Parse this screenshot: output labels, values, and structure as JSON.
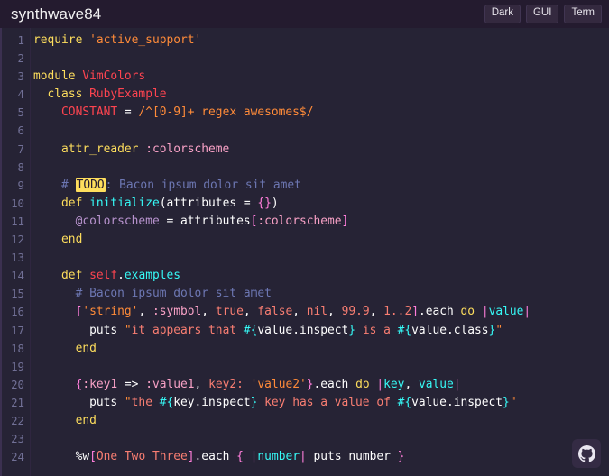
{
  "header": {
    "title": "synthwave84",
    "buttons": [
      {
        "label": "Dark",
        "name": "dark-theme-button"
      },
      {
        "label": "GUI",
        "name": "gui-mode-button"
      },
      {
        "label": "Term",
        "name": "term-mode-button"
      }
    ]
  },
  "editor": {
    "language": "ruby",
    "line_numbers": [
      "1",
      "2",
      "3",
      "4",
      "5",
      "6",
      "7",
      "8",
      "9",
      "10",
      "11",
      "12",
      "13",
      "14",
      "15",
      "16",
      "17",
      "18",
      "19",
      "20",
      "21",
      "22",
      "23",
      "24"
    ],
    "lines": [
      {
        "n": "1",
        "text": "require 'active_support'"
      },
      {
        "n": "2",
        "text": ""
      },
      {
        "n": "3",
        "text": "module VimColors"
      },
      {
        "n": "4",
        "text": "  class RubyExample"
      },
      {
        "n": "5",
        "text": "    CONSTANT = /^[0-9]+ regex awesomes$/"
      },
      {
        "n": "6",
        "text": ""
      },
      {
        "n": "7",
        "text": "    attr_reader :colorscheme"
      },
      {
        "n": "8",
        "text": ""
      },
      {
        "n": "9",
        "text": "    # TODO: Bacon ipsum dolor sit amet"
      },
      {
        "n": "10",
        "text": "    def initialize(attributes = {})"
      },
      {
        "n": "11",
        "text": "      @colorscheme = attributes[:colorscheme]"
      },
      {
        "n": "12",
        "text": "    end"
      },
      {
        "n": "13",
        "text": ""
      },
      {
        "n": "14",
        "text": "    def self.examples"
      },
      {
        "n": "15",
        "text": "      # Bacon ipsum dolor sit amet"
      },
      {
        "n": "16",
        "text": "      ['string', :symbol, true, false, nil, 99.9, 1..2].each do |value|"
      },
      {
        "n": "17",
        "text": "        puts \"it appears that #{value.inspect} is a #{value.class}\""
      },
      {
        "n": "18",
        "text": "      end"
      },
      {
        "n": "19",
        "text": ""
      },
      {
        "n": "20",
        "text": "      {:key1 => :value1, key2: 'value2'}.each do |key, value|"
      },
      {
        "n": "21",
        "text": "        puts \"the #{key.inspect} key has a value of #{value.inspect}\""
      },
      {
        "n": "22",
        "text": "      end"
      },
      {
        "n": "23",
        "text": ""
      },
      {
        "n": "24",
        "text": "      %w[One Two Three].each { |number| puts number }"
      }
    ],
    "highlight_marker": "TODO"
  },
  "footer": {
    "github_button_label": "github-icon"
  },
  "colors": {
    "page_background": "#241b2f",
    "editor_background": "#262335",
    "header_background": "#241b2f",
    "line_number": "#717096",
    "keyword": "#fede5d",
    "constant": "#fe4450",
    "string": "#ff8b39",
    "string_body": "#f97e72",
    "symbol": "#f8a1c6",
    "instance_variable": "#b893ce",
    "function": "#36f9f6",
    "bracket": "#ff7edb",
    "comment": "#6d77b3",
    "plain": "#ffffff",
    "todo_background": "#fede5d",
    "todo_text": "#241b2f",
    "button_background": "#34293f",
    "button_border": "#413552",
    "github_button_background": "#342b44"
  }
}
